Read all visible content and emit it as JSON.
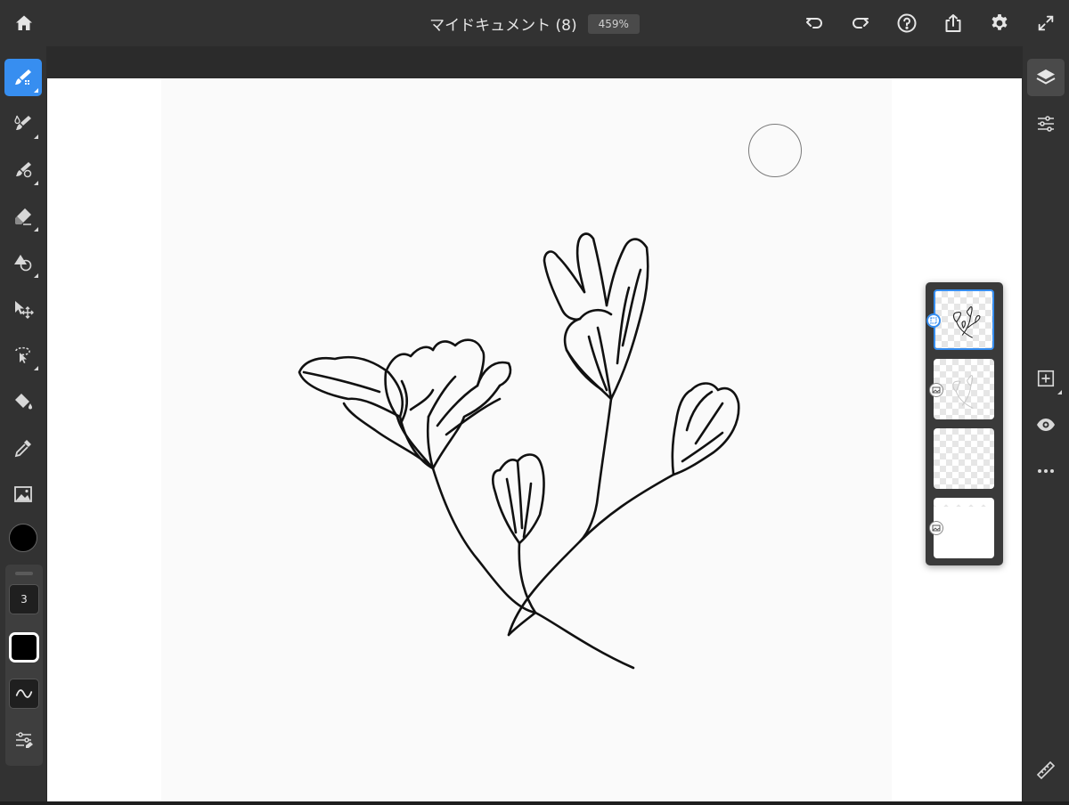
{
  "document": {
    "title": "マイドキュメント (8)",
    "zoom": "459%"
  },
  "topbar": {
    "icons": [
      "home-icon",
      "undo-icon",
      "redo-icon",
      "help-icon",
      "share-icon",
      "settings-icon",
      "fullscreen-icon"
    ]
  },
  "left_toolbar": {
    "tools": [
      "pixel-brush",
      "live-brush",
      "vector-brush",
      "eraser",
      "shape",
      "transform",
      "selection",
      "fill",
      "eyedropper",
      "image"
    ],
    "active_tool": "pixel-brush",
    "active_color": "#000000",
    "brush_size": "3"
  },
  "right_toolbar": {
    "icons": [
      "layers-icon",
      "properties-icon",
      "add-layer-icon",
      "visibility-icon",
      "more-icon",
      "ruler-icon"
    ],
    "active": "layers-icon"
  },
  "layers": {
    "count": 4,
    "selected_index": 0
  },
  "colors": {
    "accent": "#378ef0",
    "chrome": "#323232",
    "canvas": "#fafafa"
  }
}
